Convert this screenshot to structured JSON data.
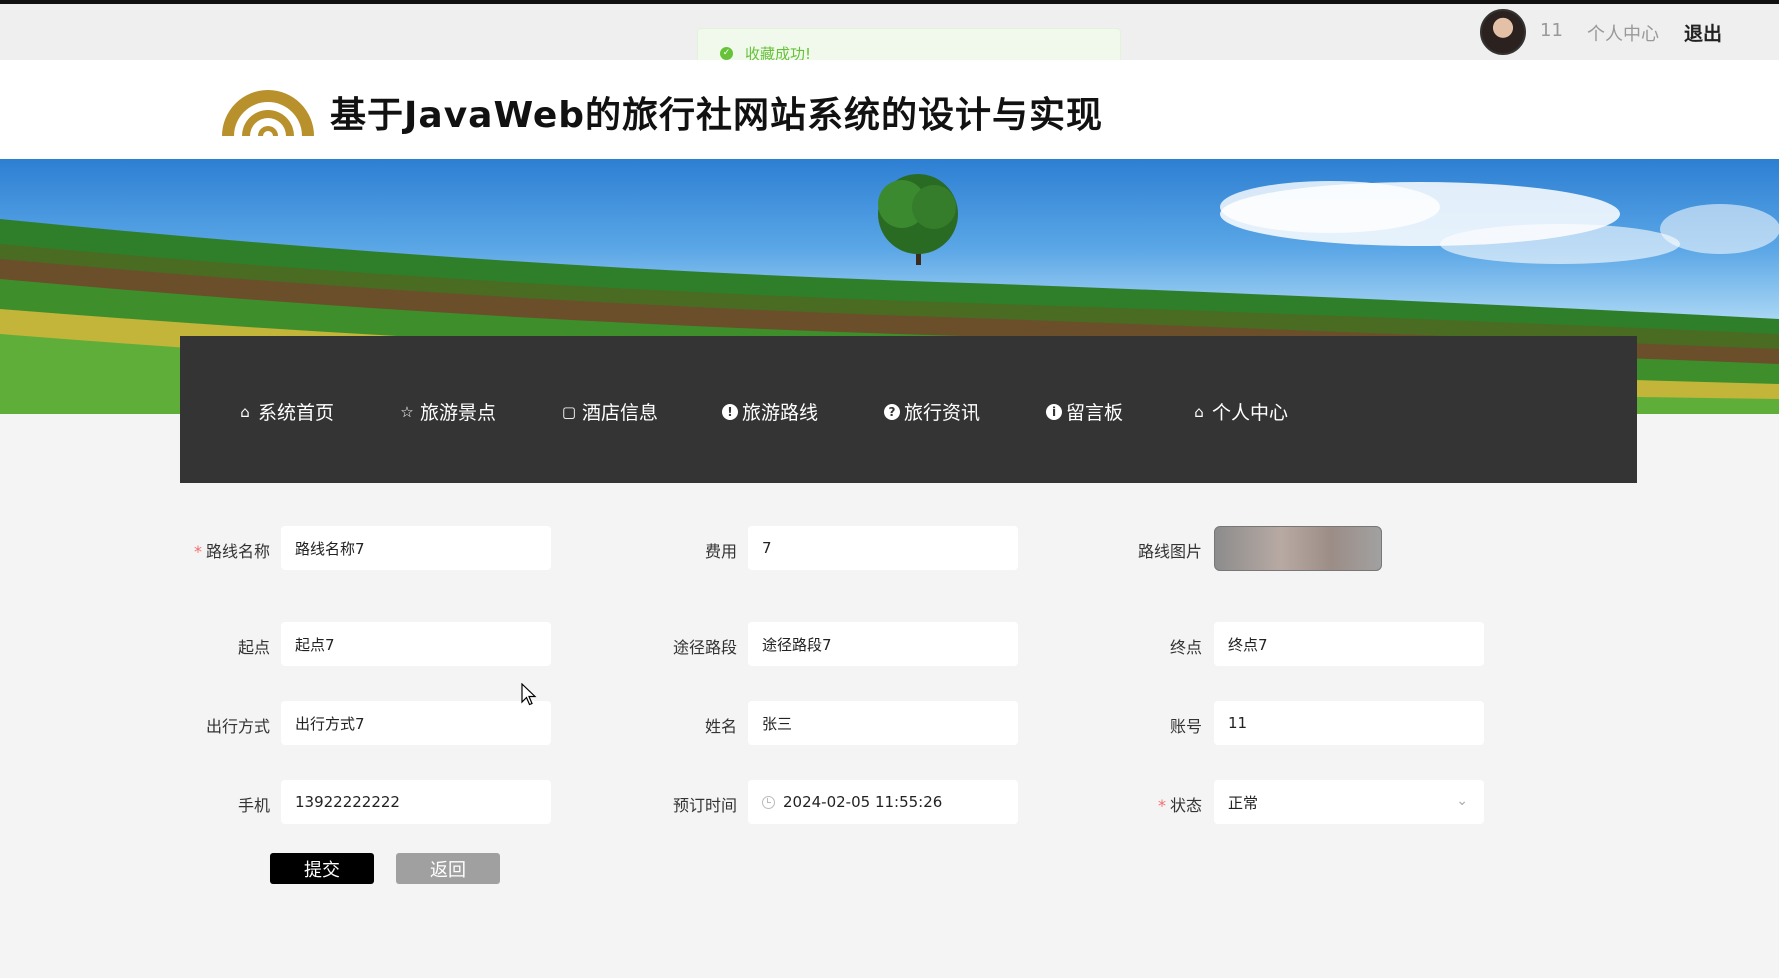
{
  "toast": {
    "message": "收藏成功!"
  },
  "topbar": {
    "user_id": "11",
    "personal_center": "个人中心",
    "logout": "退出"
  },
  "header": {
    "site_title": "基于JavaWeb的旅行社网站系统的设计与实现"
  },
  "nav": [
    {
      "label": "系统首页",
      "icon": "home-icon"
    },
    {
      "label": "旅游景点",
      "icon": "star-icon"
    },
    {
      "label": "酒店信息",
      "icon": "bag-icon"
    },
    {
      "label": "旅游路线",
      "icon": "exclamation-icon"
    },
    {
      "label": "旅行资讯",
      "icon": "question-icon"
    },
    {
      "label": "留言板",
      "icon": "info-icon"
    },
    {
      "label": "个人中心",
      "icon": "home-icon"
    }
  ],
  "form": {
    "route_name": {
      "label": "路线名称",
      "value": "路线名称7",
      "required": true
    },
    "fee": {
      "label": "费用",
      "value": "7"
    },
    "route_image": {
      "label": "路线图片"
    },
    "start": {
      "label": "起点",
      "value": "起点7"
    },
    "via": {
      "label": "途径路段",
      "value": "途径路段7"
    },
    "end": {
      "label": "终点",
      "value": "终点7"
    },
    "travel_mode": {
      "label": "出行方式",
      "value": "出行方式7"
    },
    "name": {
      "label": "姓名",
      "value": "张三"
    },
    "account": {
      "label": "账号",
      "value": "11"
    },
    "phone": {
      "label": "手机",
      "value": "13922222222"
    },
    "booking_time": {
      "label": "预订时间",
      "value": "2024-02-05 11:55:26"
    },
    "status": {
      "label": "状态",
      "value": "正常",
      "required": true
    }
  },
  "buttons": {
    "submit": "提交",
    "back": "返回"
  },
  "colors": {
    "nav_bg": "#343434",
    "toast_green": "#67c23a",
    "required_red": "#f56c6c",
    "logo_gold": "#b8902c"
  }
}
